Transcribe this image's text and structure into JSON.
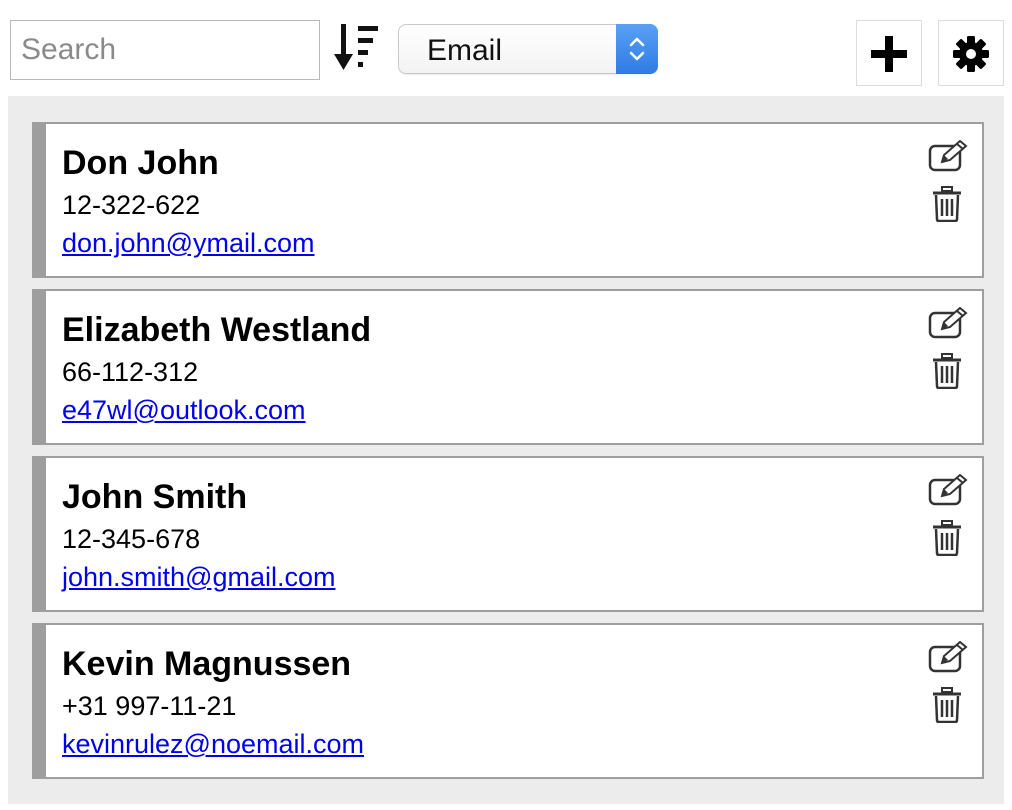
{
  "search": {
    "placeholder": "Search",
    "value": ""
  },
  "sort": {
    "icon": "sort-descending-icon",
    "field_selected": "Email"
  },
  "toolbar": {
    "add_icon": "plus-icon",
    "settings_icon": "gear-icon"
  },
  "contacts": [
    {
      "name": "Don John",
      "phone": "12-322-622",
      "email": "don.john@ymail.com"
    },
    {
      "name": "Elizabeth Westland",
      "phone": "66-112-312",
      "email": "e47wl@outlook.com"
    },
    {
      "name": "John Smith",
      "phone": "12-345-678",
      "email": "john.smith@gmail.com"
    },
    {
      "name": "Kevin Magnussen",
      "phone": "+31 997-11-21",
      "email": "kevinrulez@noemail.com"
    }
  ],
  "colors": {
    "accent": "#2f7be6",
    "link": "#0000ee",
    "card_border": "#9e9e9e",
    "panel_bg": "#ececec"
  }
}
